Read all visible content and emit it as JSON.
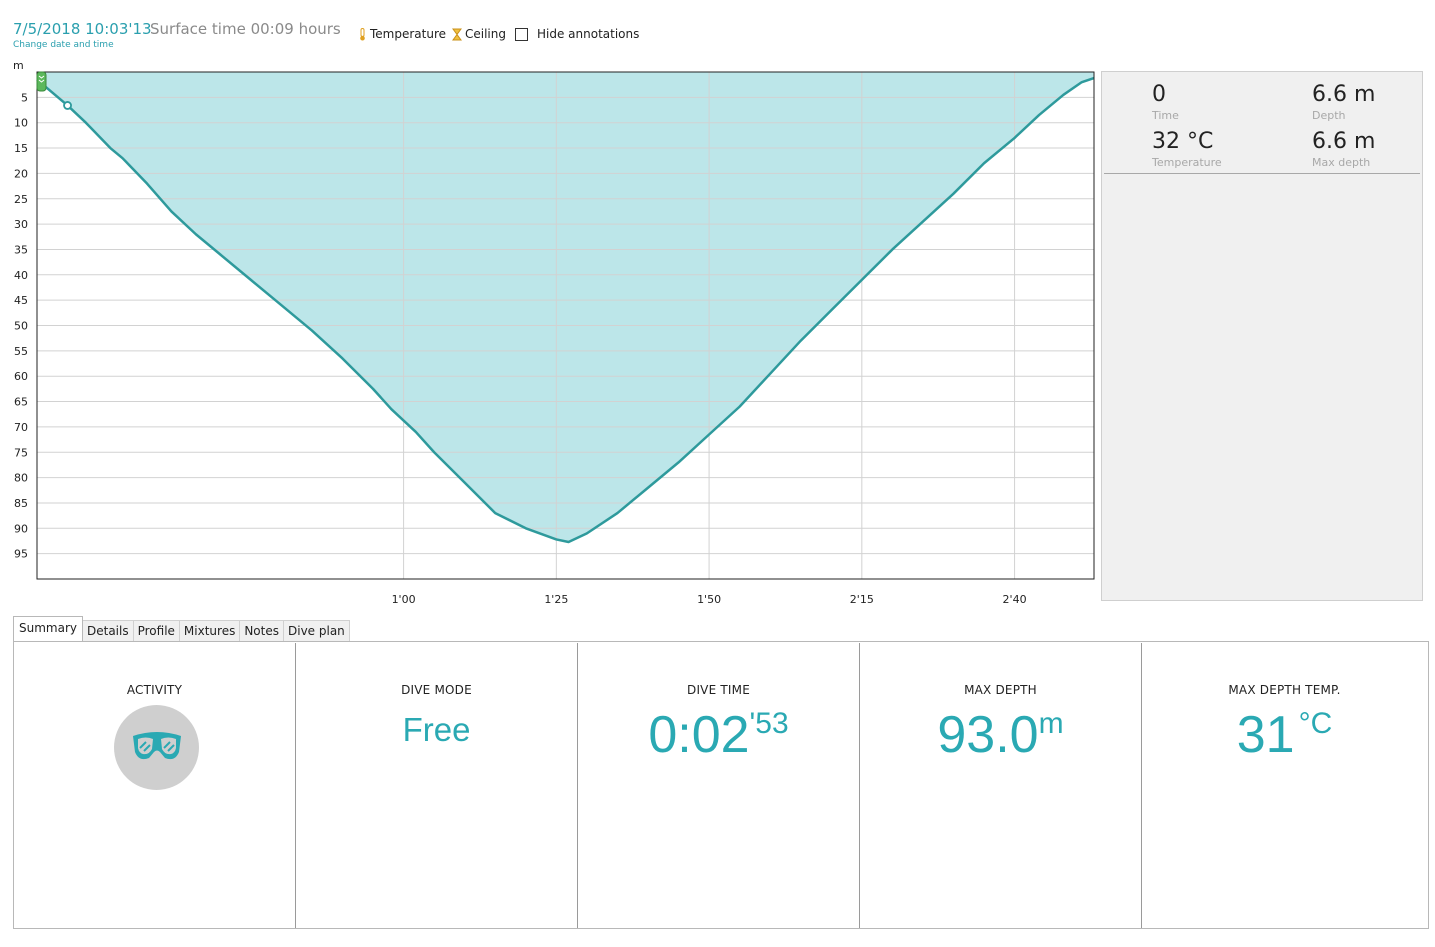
{
  "header": {
    "date_time": "7/5/2018 10:03'13",
    "surface_time": "Surface time 00:09 hours",
    "change_link": "Change date and time"
  },
  "toggles": {
    "temperature": "Temperature",
    "ceiling": "Ceiling",
    "hide_annotations": "Hide annotations",
    "hide_annotations_checked": false
  },
  "info_panel": {
    "time_value": "0",
    "time_label": "Time",
    "depth_value": "6.6 m",
    "depth_label": "Depth",
    "temperature_value": "32 °C",
    "temperature_label": "Temperature",
    "max_depth_value": "6.6 m",
    "max_depth_label": "Max depth"
  },
  "tabs": [
    "Summary",
    "Details",
    "Profile",
    "Mixtures",
    "Notes",
    "Dive plan"
  ],
  "active_tab": "Summary",
  "summary": {
    "activity_title": "ACTIVITY",
    "activity_icon": "dive-mask-icon",
    "dive_mode_title": "DIVE MODE",
    "dive_mode_value": "Free",
    "dive_time_title": "DIVE TIME",
    "dive_time_main": "0:02",
    "dive_time_sec": "'53",
    "max_depth_title": "MAX DEPTH",
    "max_depth_value": "93.0",
    "max_depth_unit": "m",
    "max_depth_temp_title": "MAX DEPTH TEMP.",
    "max_depth_temp_value": "31",
    "max_depth_temp_unit": "°C"
  },
  "colors": {
    "accent": "#2aa9b3",
    "fill": "#bce6e9",
    "line": "#2e9a9c",
    "marker": "#5cb85c"
  },
  "chart_data": {
    "type": "area",
    "title": "",
    "xlabel": "",
    "ylabel": "m",
    "x_unit": "seconds",
    "xlim": [
      0,
      173
    ],
    "ylim": [
      0,
      100
    ],
    "y_inverted": true,
    "grid": true,
    "x_ticks": [
      {
        "value": 60,
        "label": "1'00"
      },
      {
        "value": 85,
        "label": "1'25"
      },
      {
        "value": 110,
        "label": "1'50"
      },
      {
        "value": 135,
        "label": "2'15"
      },
      {
        "value": 160,
        "label": "2'40"
      }
    ],
    "y_ticks": [
      5,
      10,
      15,
      20,
      25,
      30,
      35,
      40,
      45,
      50,
      55,
      60,
      65,
      70,
      75,
      80,
      85,
      90,
      95
    ],
    "series": [
      {
        "x": [
          0,
          5,
          8,
          12,
          14,
          18,
          22,
          26,
          30,
          35,
          40,
          45,
          50,
          55,
          58,
          62,
          65,
          70,
          75,
          80,
          85,
          87,
          90,
          95,
          100,
          105,
          110,
          115,
          120,
          125,
          130,
          135,
          140,
          145,
          150,
          155,
          160,
          164,
          168,
          171,
          173
        ],
        "y": [
          1.5,
          6.6,
          10,
          15,
          17,
          22,
          27.5,
          32,
          36,
          41,
          46,
          51,
          56.5,
          62.5,
          66.5,
          71,
          75,
          81,
          87,
          90,
          92.2,
          92.7,
          91,
          87,
          82,
          77,
          71.5,
          66,
          59.5,
          53,
          47,
          41,
          35,
          29.5,
          24,
          18,
          13,
          8.5,
          4.5,
          2,
          1.2
        ]
      }
    ],
    "markers": [
      {
        "x": 5,
        "y": 6.6
      }
    ]
  }
}
